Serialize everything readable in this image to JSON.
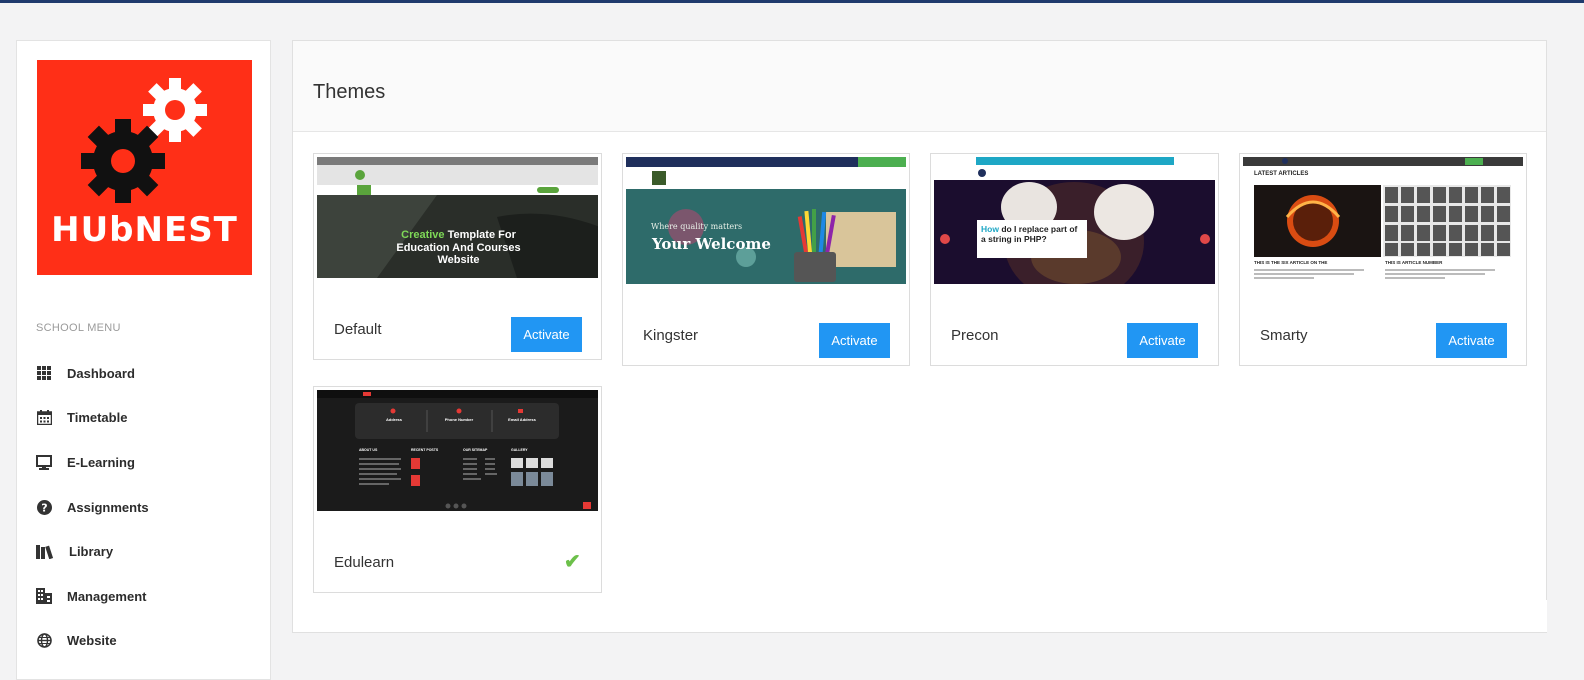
{
  "logo": {
    "text": "HUbNEST"
  },
  "sidebar": {
    "menu_header": "SCHOOL MENU",
    "items": [
      {
        "label": "Dashboard",
        "icon": "grid-icon"
      },
      {
        "label": "Timetable",
        "icon": "calendar-icon"
      },
      {
        "label": "E-Learning",
        "icon": "monitor-icon"
      },
      {
        "label": "Assignments",
        "icon": "question-circle-icon"
      },
      {
        "label": "Library",
        "icon": "books-icon"
      },
      {
        "label": "Management",
        "icon": "building-icon"
      },
      {
        "label": "Website",
        "icon": "globe-icon"
      }
    ]
  },
  "main": {
    "title": "Themes",
    "themes": [
      {
        "name": "Default",
        "status": "Activate",
        "preview": {
          "headline_accent": "Creative",
          "headline_rest": " Template For",
          "headline_line2": "Education And Courses",
          "headline_line3": "Website"
        }
      },
      {
        "name": "Kingster",
        "status": "Activate",
        "preview": {
          "tagline": "Where quality matters",
          "headline": "Your Welcome"
        }
      },
      {
        "name": "Precon",
        "status": "Activate",
        "preview": {
          "headline_accent": "How",
          "headline_rest": " do I replace part of",
          "headline_line2": "a string in PHP?"
        }
      },
      {
        "name": "Smarty",
        "status": "Activate",
        "preview": {
          "section_title": "LATEST ARTICLES",
          "caption1": "THIS IS THE SIX ARTICLE ON THE",
          "caption2": "THIS IS ARTICLE NUMBER"
        }
      },
      {
        "name": "Edulearn",
        "status": "active",
        "preview": {
          "col1": "Address",
          "col2": "Phone Number",
          "col3": "Email Address",
          "foot1": "ABOUT US",
          "foot2": "RECENT POSTS",
          "foot3": "OUR SITEMAP",
          "foot4": "GALLERY"
        }
      }
    ]
  },
  "colors": {
    "accent": "#2196f3",
    "logo_bg": "#ff2f17",
    "check": "#6cc04a",
    "topbar": "#1f3a6d"
  }
}
